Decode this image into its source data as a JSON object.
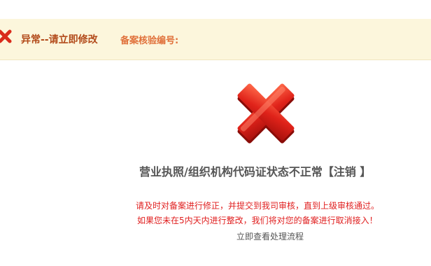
{
  "banner": {
    "status_text": "异常--请立即修改",
    "code_label": "备案核验编号:",
    "icon": "error-x-icon",
    "status_color": "#b24a1a",
    "code_color": "#e0703a",
    "background": "#fcf6dc"
  },
  "main": {
    "icon": "large-error-x-icon",
    "headline": "营业执照/组织机构代码证状态不正常【注销 】",
    "notice_line_1": "请及时对备案进行修正，并提交到我司审核，直到上级审核通过。",
    "notice_line_2": "如果您未在5内天内进行整改，我们将对您的备案进行取消接入！",
    "process_link": "立即查看处理流程",
    "notice_color": "#e02020"
  }
}
